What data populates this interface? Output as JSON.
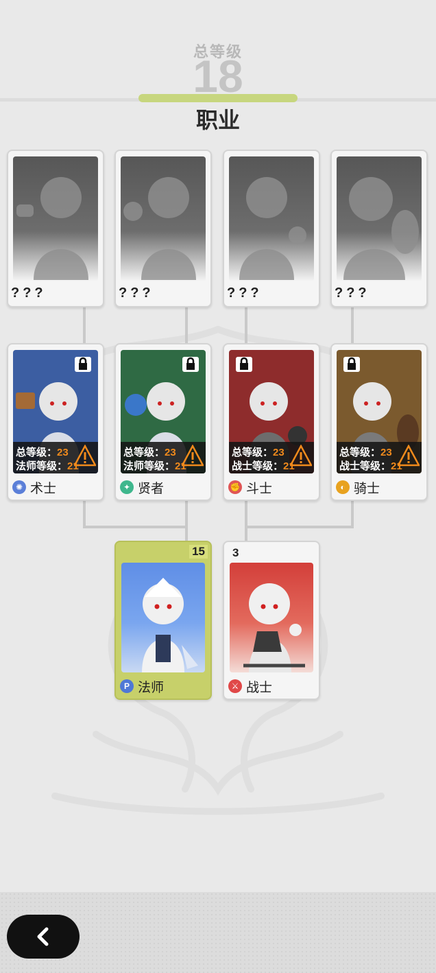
{
  "header": {
    "total_level_label": "总等级",
    "total_level_value": "18",
    "title": "职业"
  },
  "top_row": [
    {
      "name": "???"
    },
    {
      "name": "???"
    },
    {
      "name": "???"
    },
    {
      "name": "???"
    }
  ],
  "advanced_classes": [
    {
      "name": "术士",
      "req_total_label": "总等级：",
      "req_total": "23",
      "req_class_label": "法师等级：",
      "req_class": "21",
      "locked": true,
      "color": "#3c5ea2",
      "icon": "swirl-icon"
    },
    {
      "name": "贤者",
      "req_total_label": "总等级：",
      "req_total": "23",
      "req_class_label": "法师等级：",
      "req_class": "21",
      "locked": true,
      "color": "#2f6a44",
      "icon": "orb-icon"
    },
    {
      "name": "斗士",
      "req_total_label": "总等级：",
      "req_total": "23",
      "req_class_label": "战士等级：",
      "req_class": "21",
      "locked": true,
      "color": "#8e2c2c",
      "icon": "fist-icon"
    },
    {
      "name": "骑士",
      "req_total_label": "总等级：",
      "req_total": "23",
      "req_class_label": "战士等级：",
      "req_class": "21",
      "locked": true,
      "color": "#7b5a2e",
      "icon": "shield-icon"
    }
  ],
  "base_classes": [
    {
      "name": "法师",
      "level": "15",
      "selected": true,
      "icon": "mage-icon"
    },
    {
      "name": "战士",
      "level": "3",
      "selected": false,
      "icon": "sword-icon"
    }
  ],
  "colors": {
    "accent": "#c7d67e",
    "requirement_number": "#f08a1c"
  }
}
